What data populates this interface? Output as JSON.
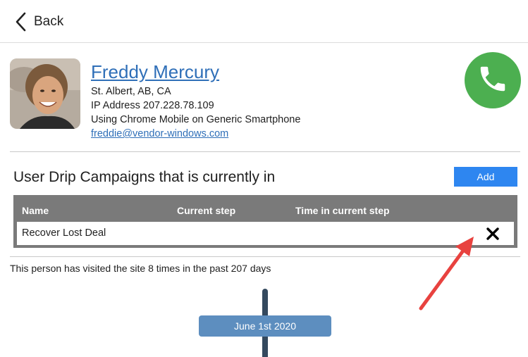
{
  "nav": {
    "back_label": "Back"
  },
  "profile": {
    "name": "Freddy Mercury",
    "location": "St. Albert, AB, CA",
    "ip": "IP Address 207.228.78.109",
    "device": "Using Chrome Mobile on Generic Smartphone",
    "email": "freddie@vendor-windows.com"
  },
  "campaigns": {
    "title": "User Drip Campaigns that is currently in",
    "add_label": "Add",
    "columns": [
      "Name",
      "Current step",
      "Time in current step"
    ],
    "rows": [
      {
        "name": "Recover Lost Deal",
        "current_step": "",
        "time_in_step": ""
      }
    ]
  },
  "visits": {
    "summary": "This person has visited the site 8 times in the past 207 days"
  },
  "timeline": {
    "date_label": "June 1st 2020"
  },
  "colors": {
    "link": "#2f6fb8",
    "call_button": "#4caf50",
    "add_button": "#2e86f0",
    "table_header": "#7a7a7a",
    "timeline_line": "#34495e",
    "date_pill": "#5d8ebf",
    "annotation_arrow": "#e8423f"
  },
  "icons": {
    "back": "chevron-left-icon",
    "call": "phone-icon",
    "remove": "close-icon"
  }
}
